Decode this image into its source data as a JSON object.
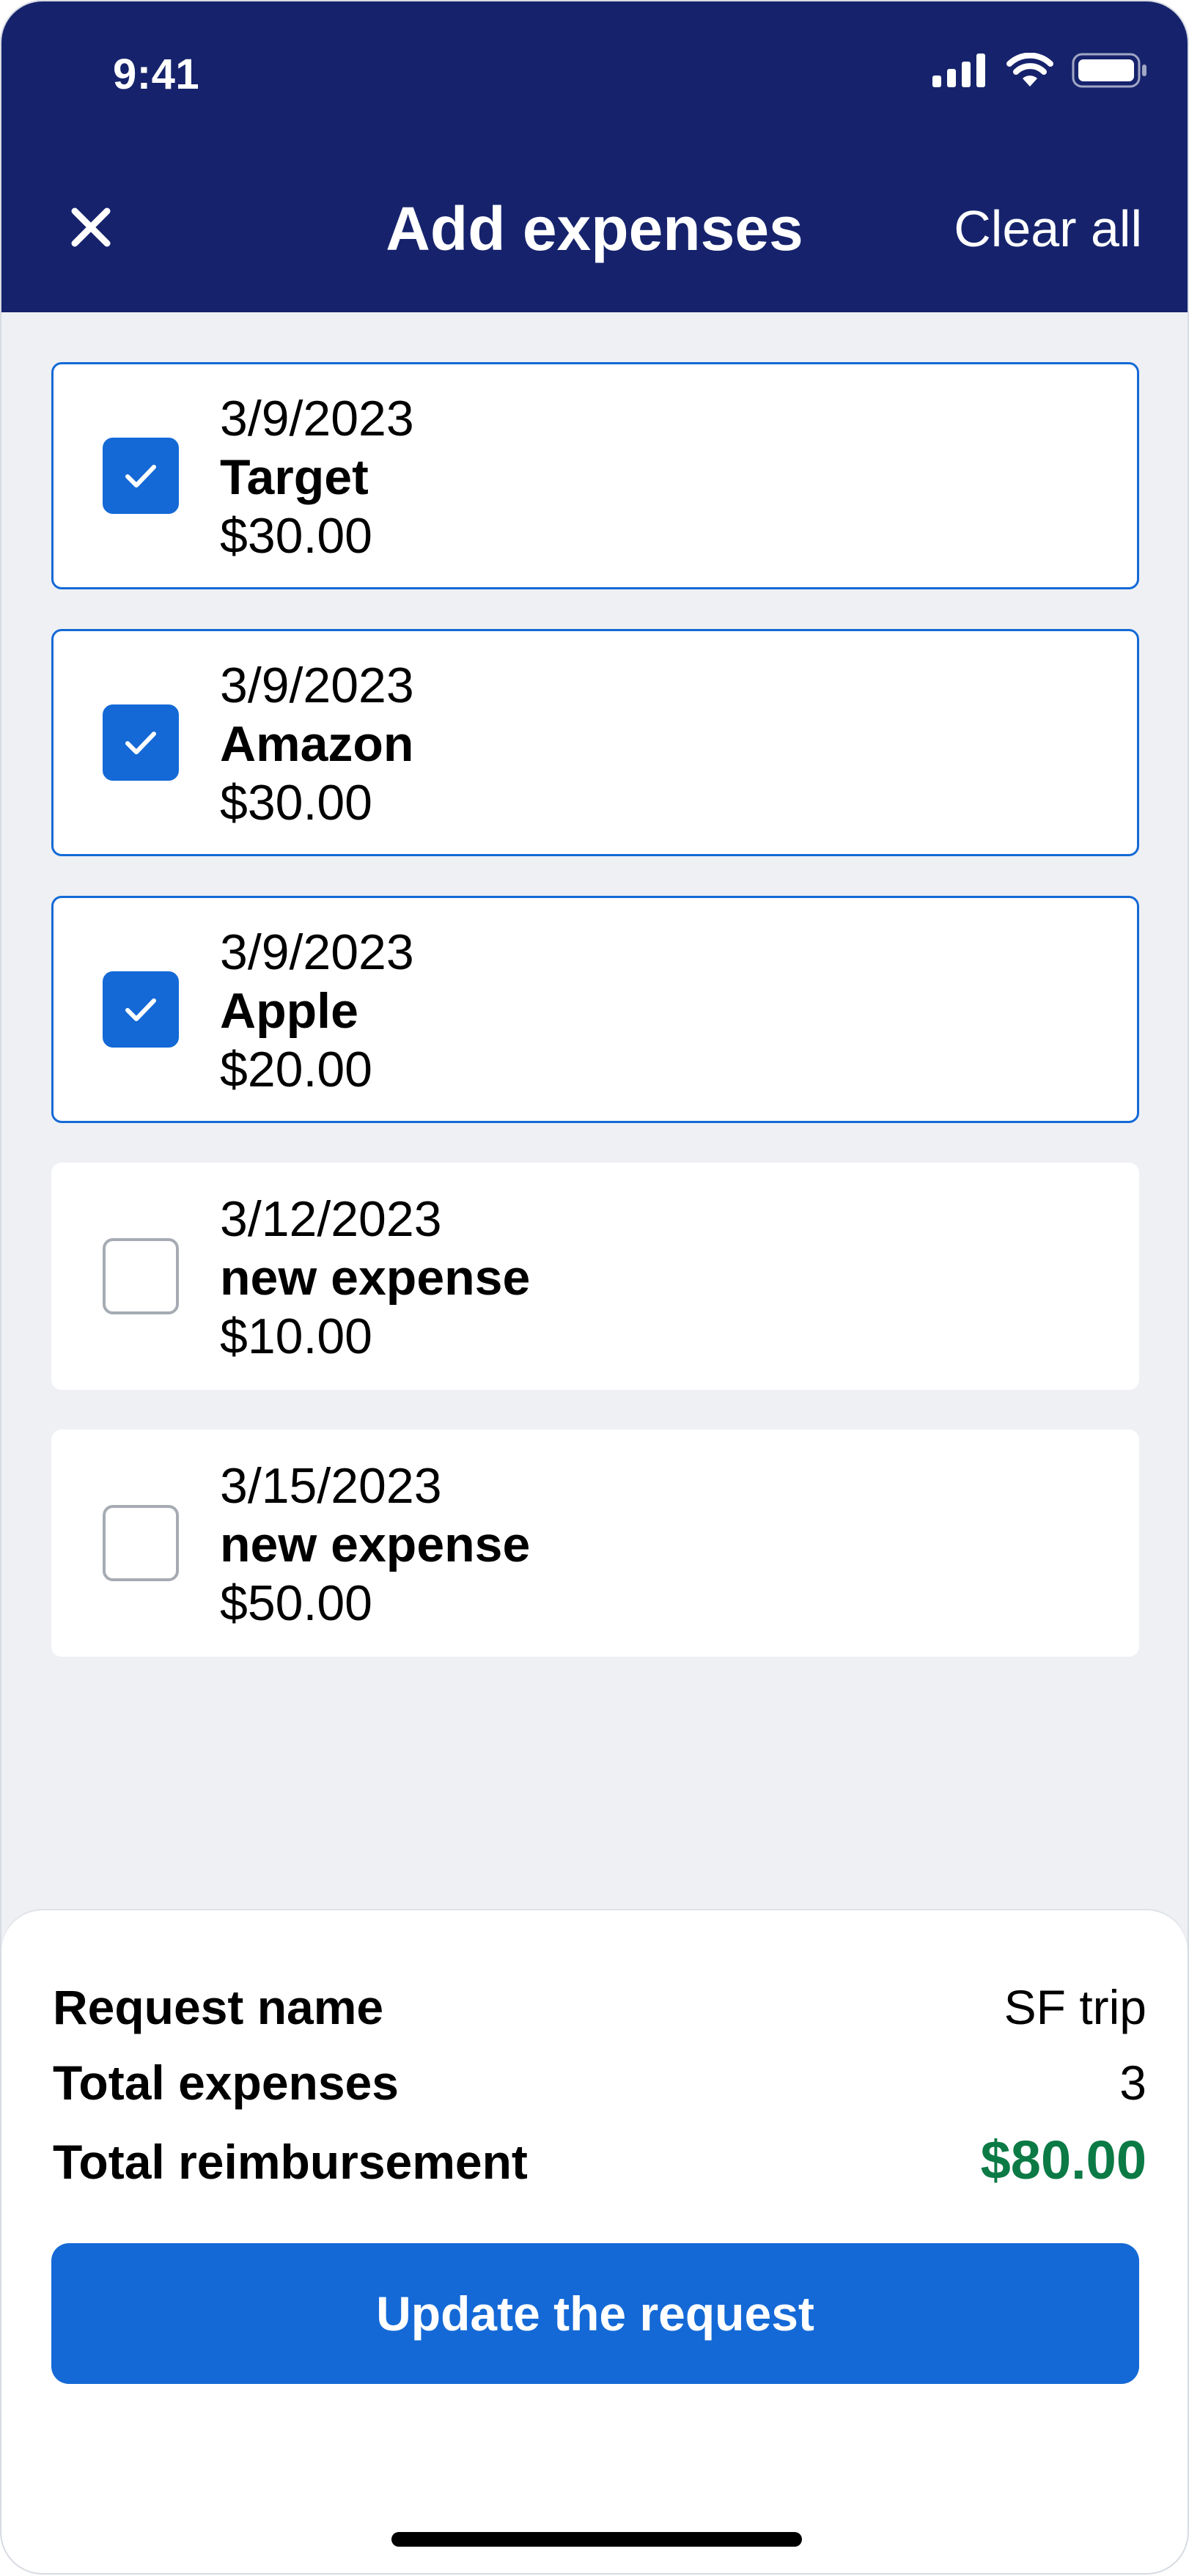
{
  "status_bar": {
    "time": "9:41",
    "icons": [
      "cellular-signal-icon",
      "wifi-icon",
      "battery-icon"
    ]
  },
  "header": {
    "close_icon": "close-icon",
    "title": "Add expenses",
    "clear_all_label": "Clear all",
    "background_color": "#16236c"
  },
  "expenses": [
    {
      "date": "3/9/2023",
      "name": "Target",
      "amount": "$30.00",
      "checked": true
    },
    {
      "date": "3/9/2023",
      "name": "Amazon",
      "amount": "$30.00",
      "checked": true
    },
    {
      "date": "3/9/2023",
      "name": "Apple",
      "amount": "$20.00",
      "checked": true
    },
    {
      "date": "3/12/2023",
      "name": "new expense",
      "amount": "$10.00",
      "checked": false
    },
    {
      "date": "3/15/2023",
      "name": "new expense",
      "amount": "$50.00",
      "checked": false
    }
  ],
  "summary": {
    "request_name_label": "Request name",
    "request_name_value": "SF trip",
    "total_expenses_label": "Total expenses",
    "total_expenses_value": "3",
    "total_reimbursement_label": "Total reimbursement",
    "total_reimbursement_value": "$80.00"
  },
  "update_button_label": "Update the request",
  "colors": {
    "accent": "#1469d6",
    "reimbursement_green": "#0c7a45",
    "page_background": "#eef0f4"
  }
}
